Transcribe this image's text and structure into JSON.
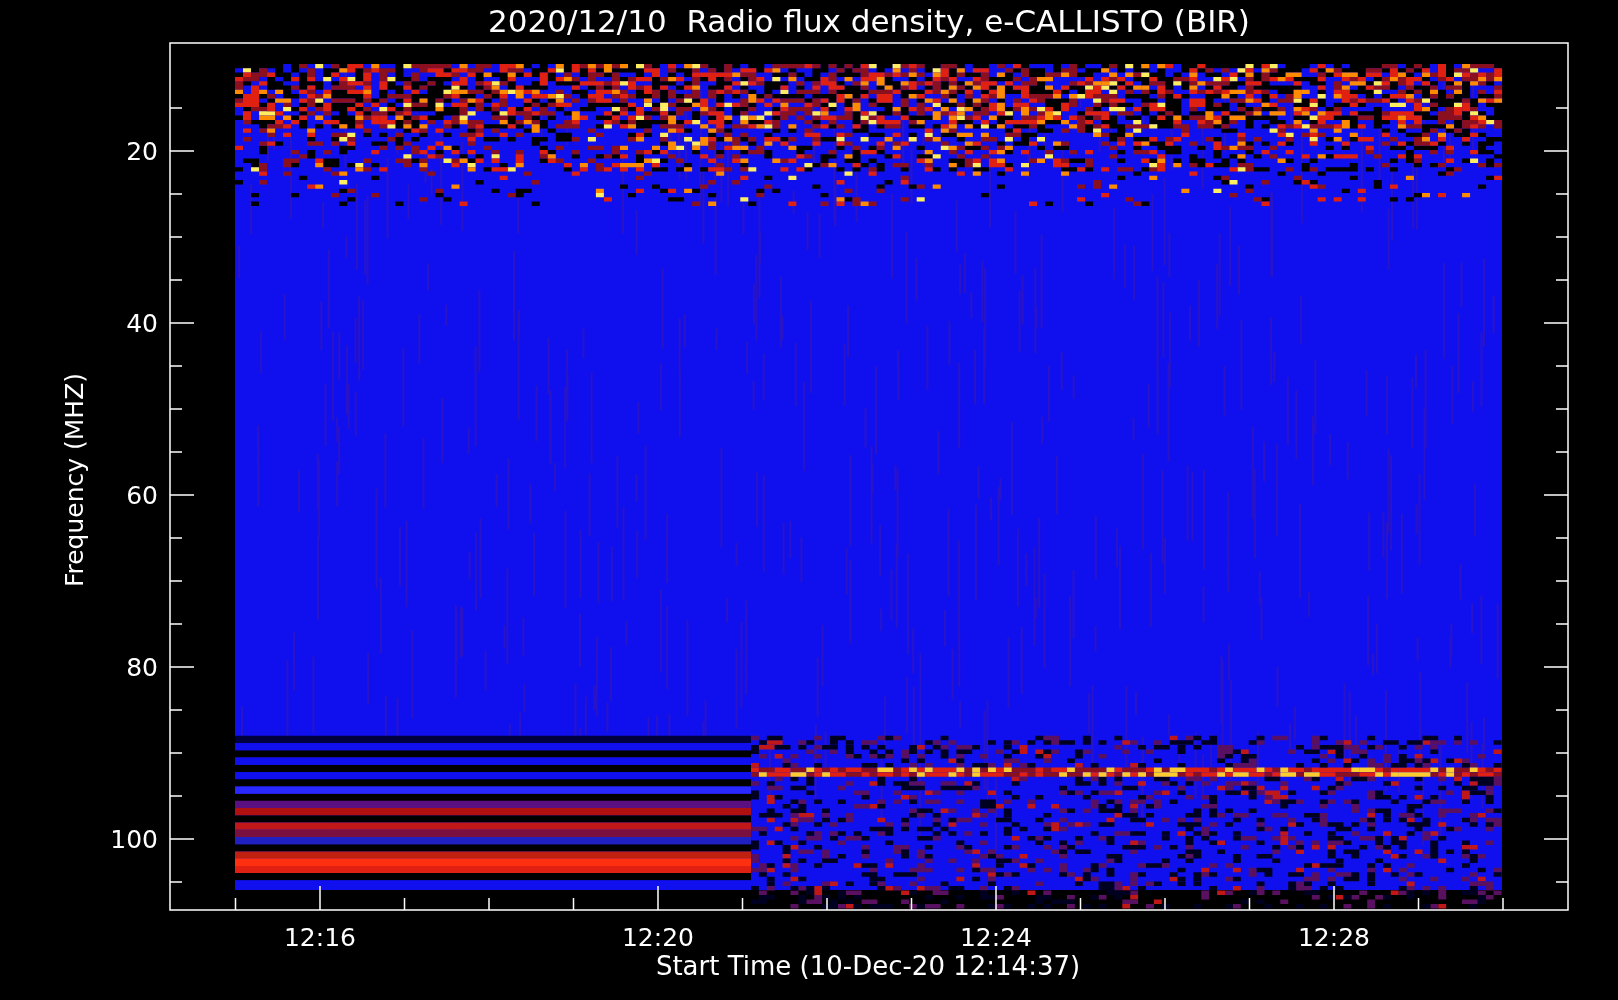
{
  "plot": {
    "title": "2020/12/10  Radio flux density, e-CALLISTO (BIR)",
    "ylabel": "Frequency (MHZ)",
    "xlabel": "Start Time (10-Dec-20 12:14:37)",
    "yticks": [
      {
        "label": "20"
      },
      {
        "label": "40"
      },
      {
        "label": "60"
      },
      {
        "label": "80"
      },
      {
        "label": "100"
      }
    ],
    "xticks": [
      {
        "label": "12:16"
      },
      {
        "label": "12:20"
      },
      {
        "label": "12:24"
      },
      {
        "label": "12:28"
      }
    ]
  }
}
